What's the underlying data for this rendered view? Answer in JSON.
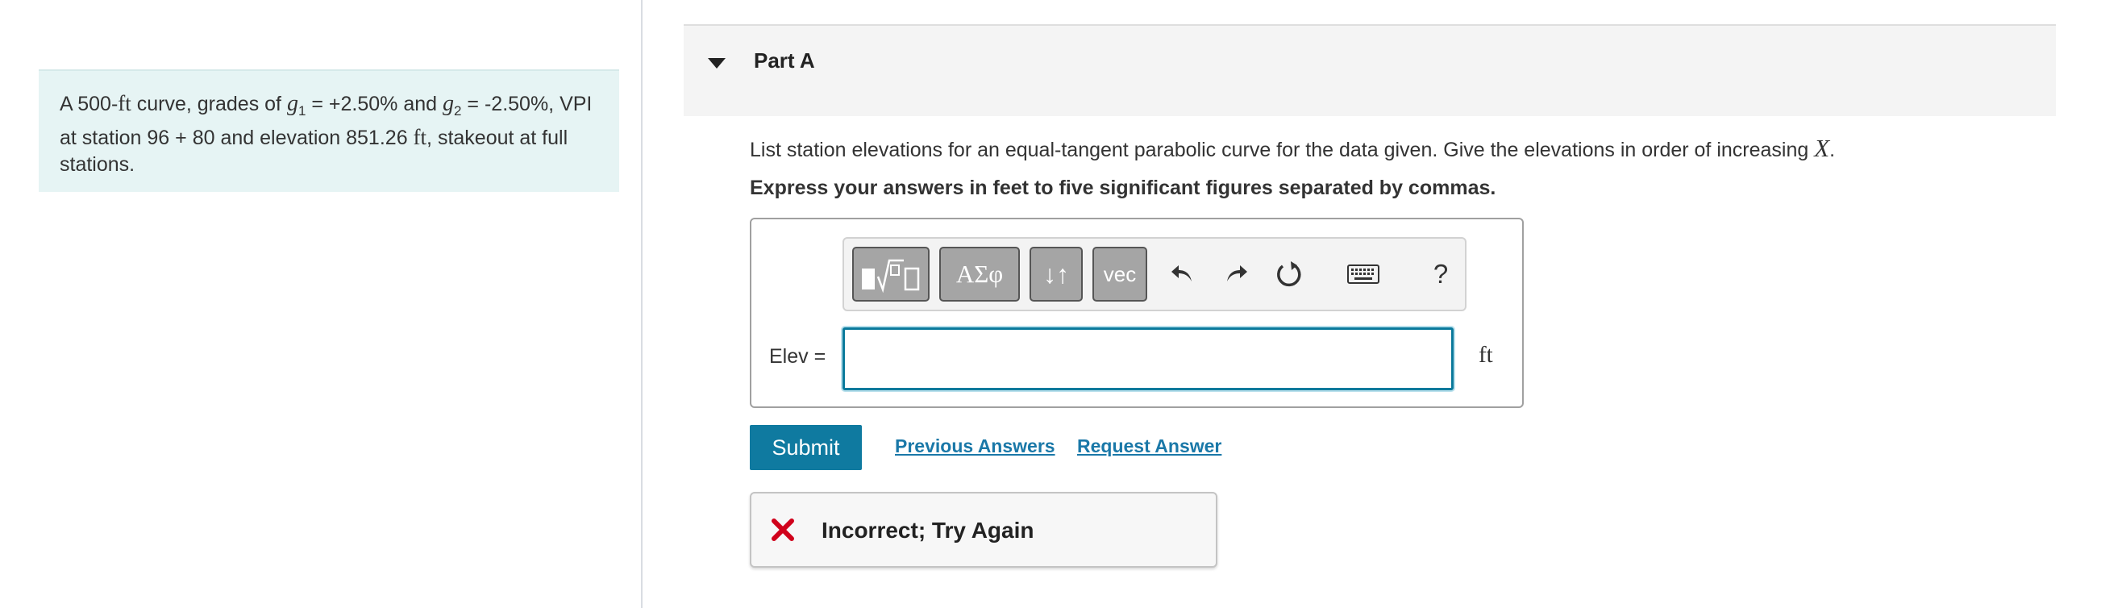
{
  "problem": {
    "text_1": "A 500-",
    "unit_ft_1": "ft",
    "text_2": " curve, grades of ",
    "g1_symbol": "g",
    "g1_sub": "1",
    "text_3": " = +2.50% and ",
    "g2_symbol": "g",
    "g2_sub": "2",
    "text_4": " = -2.50%, VPI at station 96 + 80 and elevation 851.26 ",
    "unit_ft_2": "ft",
    "text_5": ", stakeout at full stations."
  },
  "part": {
    "title": "Part A"
  },
  "question": {
    "text": "List station elevations for an equal-tangent parabolic curve for the data given. Give the elevations in order of increasing ",
    "variable": "X",
    "end": "."
  },
  "instruction": "Express your answers in feet to five significant figures separated by commas.",
  "toolbar": {
    "greek_label": "ΑΣφ",
    "arrows_label": "↓↑",
    "vec_label": "vec",
    "help_label": "?"
  },
  "answer": {
    "label": "Elev =",
    "value": "",
    "unit": "ft"
  },
  "actions": {
    "submit_label": "Submit",
    "previous_answers_label": "Previous Answers",
    "request_answer_label": "Request Answer"
  },
  "feedback": {
    "text": "Incorrect; Try Again"
  },
  "colors": {
    "accent": "#0f7aa0",
    "error": "#d0021b",
    "problem_bg": "#e6f4f4"
  }
}
